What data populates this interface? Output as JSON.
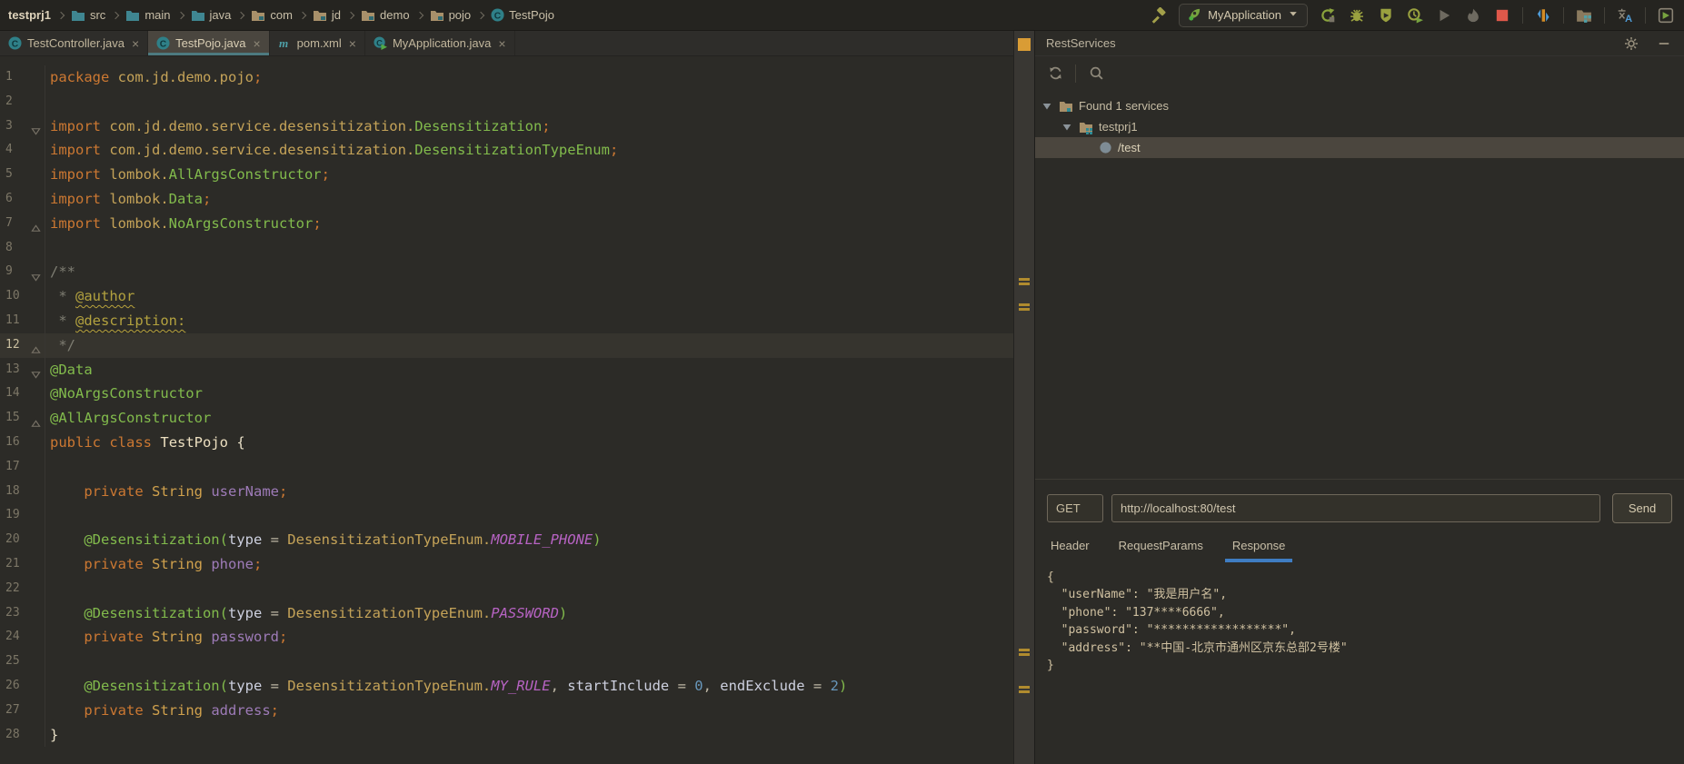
{
  "navbar": {
    "project": "testprj1",
    "crumbs": [
      {
        "label": "src",
        "icon": "folder-src"
      },
      {
        "label": "main",
        "icon": "folder-src"
      },
      {
        "label": "java",
        "icon": "folder-src"
      },
      {
        "label": "com",
        "icon": "folder-pkg"
      },
      {
        "label": "jd",
        "icon": "folder-pkg"
      },
      {
        "label": "demo",
        "icon": "folder-pkg"
      },
      {
        "label": "pojo",
        "icon": "folder-pkg"
      },
      {
        "label": "TestPojo",
        "icon": "class"
      }
    ]
  },
  "run_toolbar": {
    "build_icon": "hammer",
    "config": {
      "icon": "spring-leaf",
      "name": "MyApplication"
    },
    "groups": [
      [
        "rerun",
        "debug",
        "coverage",
        "profiler",
        "run-disabled",
        "flame-disabled",
        "stop"
      ],
      [
        "plugin-bars"
      ],
      [
        "modules"
      ],
      [
        "translate"
      ],
      [
        "services"
      ]
    ]
  },
  "editor_tabs": [
    {
      "label": "TestController.java",
      "icon": "class",
      "close": "×",
      "active": false
    },
    {
      "label": "TestPojo.java",
      "icon": "class",
      "close": "×",
      "active": true
    },
    {
      "label": "pom.xml",
      "icon": "maven",
      "close": "×",
      "active": false
    },
    {
      "label": "MyApplication.java",
      "icon": "class-run",
      "close": "×",
      "active": false
    }
  ],
  "editor": {
    "stripe_markers": [
      272,
      300,
      680,
      721
    ],
    "lines": [
      {
        "n": "1",
        "fold": null,
        "current": false,
        "tokens": [
          [
            "kw",
            "package"
          ],
          [
            "pln",
            " "
          ],
          [
            "pkg",
            "com.jd.demo.pojo"
          ],
          [
            "sem",
            ";"
          ]
        ]
      },
      {
        "n": "2",
        "fold": null,
        "current": false,
        "tokens": []
      },
      {
        "n": "3",
        "fold": "down",
        "current": false,
        "tokens": [
          [
            "kw",
            "import"
          ],
          [
            "pln",
            " "
          ],
          [
            "pkg",
            "com.jd.demo.service.desensitization."
          ],
          [
            "cls",
            "Desensitization"
          ],
          [
            "sem",
            ";"
          ]
        ]
      },
      {
        "n": "4",
        "fold": null,
        "current": false,
        "tokens": [
          [
            "kw",
            "import"
          ],
          [
            "pln",
            " "
          ],
          [
            "pkg",
            "com.jd.demo.service.desensitization."
          ],
          [
            "cls",
            "DesensitizationTypeEnum"
          ],
          [
            "sem",
            ";"
          ]
        ]
      },
      {
        "n": "5",
        "fold": null,
        "current": false,
        "tokens": [
          [
            "kw",
            "import"
          ],
          [
            "pln",
            " "
          ],
          [
            "pkg",
            "lombok."
          ],
          [
            "cls",
            "AllArgsConstructor"
          ],
          [
            "sem",
            ";"
          ]
        ]
      },
      {
        "n": "6",
        "fold": null,
        "current": false,
        "tokens": [
          [
            "kw",
            "import"
          ],
          [
            "pln",
            " "
          ],
          [
            "pkg",
            "lombok."
          ],
          [
            "cls",
            "Data"
          ],
          [
            "sem",
            ";"
          ]
        ]
      },
      {
        "n": "7",
        "fold": "up",
        "current": false,
        "tokens": [
          [
            "kw",
            "import"
          ],
          [
            "pln",
            " "
          ],
          [
            "pkg",
            "lombok."
          ],
          [
            "cls",
            "NoArgsConstructor"
          ],
          [
            "sem",
            ";"
          ]
        ]
      },
      {
        "n": "8",
        "fold": null,
        "current": false,
        "tokens": []
      },
      {
        "n": "9",
        "fold": "down",
        "current": false,
        "tokens": [
          [
            "cmt",
            "/**"
          ]
        ]
      },
      {
        "n": "10",
        "fold": null,
        "current": false,
        "tokens": [
          [
            "cmt",
            " * "
          ],
          [
            "tag",
            "@author"
          ]
        ]
      },
      {
        "n": "11",
        "fold": null,
        "current": false,
        "tokens": [
          [
            "cmt",
            " * "
          ],
          [
            "tag",
            "@description:"
          ]
        ]
      },
      {
        "n": "12",
        "fold": "up",
        "current": true,
        "tokens": [
          [
            "cmt",
            " */"
          ]
        ]
      },
      {
        "n": "13",
        "fold": "down",
        "current": false,
        "tokens": [
          [
            "ann",
            "@Data"
          ]
        ]
      },
      {
        "n": "14",
        "fold": null,
        "current": false,
        "tokens": [
          [
            "ann",
            "@NoArgsConstructor"
          ]
        ]
      },
      {
        "n": "15",
        "fold": "up",
        "current": false,
        "tokens": [
          [
            "ann",
            "@AllArgsConstructor"
          ]
        ]
      },
      {
        "n": "16",
        "fold": null,
        "current": false,
        "tokens": [
          [
            "kw",
            "public"
          ],
          [
            "pln",
            " "
          ],
          [
            "kw",
            "class"
          ],
          [
            "pln",
            " "
          ],
          [
            "cn",
            "TestPojo"
          ],
          [
            "pln",
            " "
          ],
          [
            "br",
            "{"
          ]
        ]
      },
      {
        "n": "17",
        "fold": null,
        "current": false,
        "tokens": []
      },
      {
        "n": "18",
        "fold": null,
        "current": false,
        "tokens": [
          [
            "pln",
            "    "
          ],
          [
            "kw",
            "private"
          ],
          [
            "pln",
            " "
          ],
          [
            "typ",
            "String"
          ],
          [
            "pln",
            " "
          ],
          [
            "fld",
            "userName"
          ],
          [
            "sem",
            ";"
          ]
        ]
      },
      {
        "n": "19",
        "fold": null,
        "current": false,
        "tokens": []
      },
      {
        "n": "20",
        "fold": null,
        "current": false,
        "tokens": [
          [
            "pln",
            "    "
          ],
          [
            "ann",
            "@Desensitization("
          ],
          [
            "att",
            "type"
          ],
          [
            "op",
            " = "
          ],
          [
            "pkg",
            "DesensitizationTypeEnum."
          ],
          [
            "con",
            "MOBILE_PHONE"
          ],
          [
            "ann",
            ")"
          ]
        ]
      },
      {
        "n": "21",
        "fold": null,
        "current": false,
        "tokens": [
          [
            "pln",
            "    "
          ],
          [
            "kw",
            "private"
          ],
          [
            "pln",
            " "
          ],
          [
            "typ",
            "String"
          ],
          [
            "pln",
            " "
          ],
          [
            "fld",
            "phone"
          ],
          [
            "sem",
            ";"
          ]
        ]
      },
      {
        "n": "22",
        "fold": null,
        "current": false,
        "tokens": []
      },
      {
        "n": "23",
        "fold": null,
        "current": false,
        "tokens": [
          [
            "pln",
            "    "
          ],
          [
            "ann",
            "@Desensitization("
          ],
          [
            "att",
            "type"
          ],
          [
            "op",
            " = "
          ],
          [
            "pkg",
            "DesensitizationTypeEnum."
          ],
          [
            "con",
            "PASSWORD"
          ],
          [
            "ann",
            ")"
          ]
        ]
      },
      {
        "n": "24",
        "fold": null,
        "current": false,
        "tokens": [
          [
            "pln",
            "    "
          ],
          [
            "kw",
            "private"
          ],
          [
            "pln",
            " "
          ],
          [
            "typ",
            "String"
          ],
          [
            "pln",
            " "
          ],
          [
            "fld",
            "password"
          ],
          [
            "sem",
            ";"
          ]
        ]
      },
      {
        "n": "25",
        "fold": null,
        "current": false,
        "tokens": []
      },
      {
        "n": "26",
        "fold": null,
        "current": false,
        "tokens": [
          [
            "pln",
            "    "
          ],
          [
            "ann",
            "@Desensitization("
          ],
          [
            "att",
            "type"
          ],
          [
            "op",
            " = "
          ],
          [
            "pkg",
            "DesensitizationTypeEnum."
          ],
          [
            "con",
            "MY_RULE"
          ],
          [
            "op",
            ", "
          ],
          [
            "att",
            "startInclude"
          ],
          [
            "op",
            " = "
          ],
          [
            "num",
            "0"
          ],
          [
            "op",
            ", "
          ],
          [
            "att",
            "endExclude"
          ],
          [
            "op",
            " = "
          ],
          [
            "num",
            "2"
          ],
          [
            "ann",
            ")"
          ]
        ]
      },
      {
        "n": "27",
        "fold": null,
        "current": false,
        "tokens": [
          [
            "pln",
            "    "
          ],
          [
            "kw",
            "private"
          ],
          [
            "pln",
            " "
          ],
          [
            "typ",
            "String"
          ],
          [
            "pln",
            " "
          ],
          [
            "fld",
            "address"
          ],
          [
            "sem",
            ";"
          ]
        ]
      },
      {
        "n": "28",
        "fold": null,
        "current": false,
        "tokens": [
          [
            "br",
            "}"
          ]
        ]
      }
    ]
  },
  "rest_panel": {
    "title": "RestServices",
    "header_icons": [
      "gear",
      "minimize"
    ],
    "toolbar_icons": [
      "refresh",
      "search"
    ],
    "tree": [
      {
        "level": 0,
        "caret": true,
        "icon": "folder-services",
        "label": "Found 1 services",
        "selected": false
      },
      {
        "level": 1,
        "caret": true,
        "icon": "folder-module",
        "label": "testprj1",
        "selected": false
      },
      {
        "level": 2,
        "caret": false,
        "icon": "endpoint",
        "label": "/test",
        "selected": true
      }
    ],
    "request": {
      "method": "GET",
      "url": "http://localhost:80/test",
      "send_label": "Send"
    },
    "tabs": [
      {
        "label": "Header",
        "active": false
      },
      {
        "label": "RequestParams",
        "active": false
      },
      {
        "label": "Response",
        "active": true
      }
    ],
    "response_lines": [
      "{",
      "  \"userName\": \"我是用户名\",",
      "  \"phone\": \"137****6666\",",
      "  \"password\": \"******************\",",
      "  \"address\": \"**中国-北京市通州区京东总部2号楼\"",
      "}"
    ]
  },
  "colors": {
    "accent_blue": "#3f7dc2",
    "tab_accent": "#4d7a80",
    "selection": "#4b463e",
    "warning_orange": "#d99c35",
    "stop_red": "#e0584a",
    "run_green": "#8aa33c"
  }
}
